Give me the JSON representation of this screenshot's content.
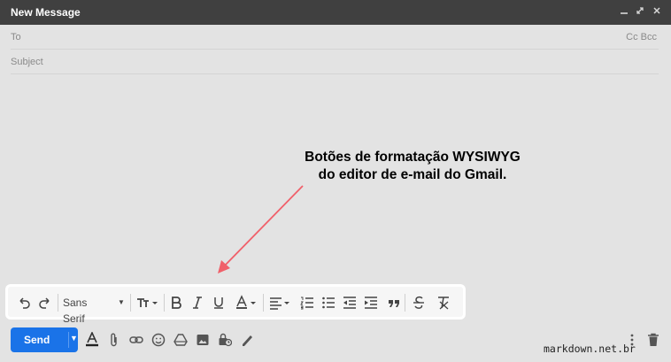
{
  "window": {
    "title": "New Message",
    "controls": [
      "minimize-icon",
      "expand-icon",
      "close-icon"
    ]
  },
  "fields": {
    "to_label": "To",
    "cc_bcc": "Cc Bcc",
    "subject_label": "Subject"
  },
  "annotation": {
    "line1": "Botões de formatação WYSIWYG",
    "line2": "do editor de e-mail do Gmail.",
    "arrow_color": "#f0606a"
  },
  "format_toolbar": {
    "font_family": "Sans Serif",
    "buttons": [
      "undo-icon",
      "redo-icon",
      "font-family-select",
      "text-size-icon",
      "bold-icon",
      "italic-icon",
      "underline-icon",
      "text-color-icon",
      "align-icon",
      "numbered-list-icon",
      "bulleted-list-icon",
      "indent-less-icon",
      "indent-more-icon",
      "quote-icon",
      "strikethrough-icon",
      "remove-formatting-icon"
    ]
  },
  "bottom_toolbar": {
    "send_label": "Send",
    "send_color": "#1a73e8",
    "tools": [
      "formatting-options-icon",
      "attach-icon",
      "link-icon",
      "emoji-icon",
      "drive-icon",
      "photo-icon",
      "confidential-icon",
      "signature-icon",
      "more-options-icon",
      "delete-icon"
    ]
  },
  "watermark": "markdown.net.br"
}
